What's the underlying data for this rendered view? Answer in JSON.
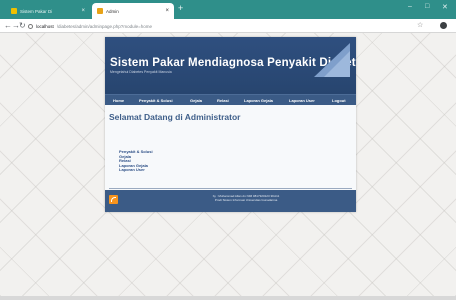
{
  "browser": {
    "tabs": [
      {
        "label": "Sistem Pakar Di",
        "active": false
      },
      {
        "label": "Admin",
        "active": true
      }
    ],
    "new_tab": "+",
    "url_host": "localhost",
    "url_path": "/diabetes/admin/adminpage.php?module=home",
    "window_controls": [
      "–",
      "□",
      "✕"
    ]
  },
  "site": {
    "title": "Sistem Pakar Mendiagnosa Penyakit Diabetes",
    "subtitle": "Mengetahui Diabetes Penyakit Manusia",
    "menu": [
      "Home",
      "Penyakit & Solusi",
      "Gejala",
      "Relasi",
      "Laporan Gejala",
      "Laporan User",
      "Logout"
    ],
    "heading": "Selamat Datang di Administrator",
    "links": [
      "Penyakit & Solusi",
      "Gejala",
      "Relasi",
      "Laporan Gejala",
      "Laporan User"
    ],
    "footer_lines": [
      "by : Muhammad Allan dn NIM 0817320123 3KA11",
      "Prodi Sistem Informasi Universitas Gunadarma"
    ]
  },
  "colors": {
    "tabbar": "#2f8f8a",
    "header": "#2f4f7f",
    "menu": "#3b5b86",
    "heading": "#3f5f8a"
  }
}
